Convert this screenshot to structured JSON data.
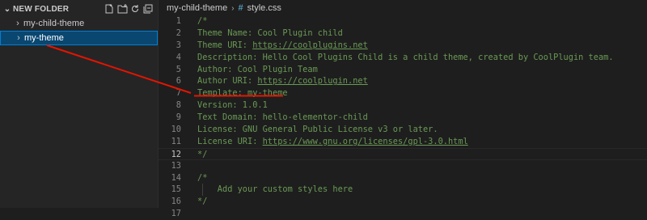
{
  "explorer": {
    "folder_title": "NEW FOLDER",
    "actions": [
      "new-file-icon",
      "new-folder-icon",
      "refresh-icon",
      "collapse-all-icon"
    ],
    "items": [
      {
        "label": "my-child-theme",
        "selected": false
      },
      {
        "label": "my-theme",
        "selected": true
      }
    ]
  },
  "breadcrumb": {
    "folder": "my-child-theme",
    "hash": "#",
    "file": "style.css"
  },
  "editor": {
    "current_line": 12,
    "lines": [
      {
        "num": "1",
        "text": "/*"
      },
      {
        "num": "2",
        "text": "Theme Name: Cool Plugin child"
      },
      {
        "num": "3",
        "prefix": "Theme URI: ",
        "link": "https://coolplugins.net"
      },
      {
        "num": "4",
        "text": "Description: Hello Cool Plugins Child is a child theme, created by CoolPlugin team."
      },
      {
        "num": "5",
        "text": "Author: Cool Plugin Team"
      },
      {
        "num": "6",
        "prefix": "Author URI: ",
        "link": "https://coolplugin.net"
      },
      {
        "num": "7",
        "text": "Template: my-theme"
      },
      {
        "num": "8",
        "text": "Version: 1.0.1"
      },
      {
        "num": "9",
        "text": "Text Domain: hello-elementor-child"
      },
      {
        "num": "10",
        "text": "License: GNU General Public License v3 or later."
      },
      {
        "num": "11",
        "prefix": "License URI: ",
        "link": "https://www.gnu.org/licenses/gpl-3.0.html"
      },
      {
        "num": "12",
        "text": "*/"
      },
      {
        "num": "13",
        "text": ""
      },
      {
        "num": "14",
        "text": "/*"
      },
      {
        "num": "15",
        "text": "    Add your custom styles here"
      },
      {
        "num": "16",
        "text": "*/"
      },
      {
        "num": "17",
        "text": ""
      }
    ]
  },
  "colors": {
    "comment": "#6a9955",
    "annotation": "#e51400",
    "selection": "#094771"
  }
}
